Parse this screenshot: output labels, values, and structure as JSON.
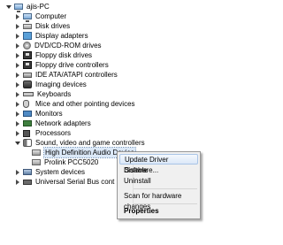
{
  "tree": {
    "root": "ajis-PC",
    "categories": [
      {
        "label": "Computer",
        "icon": "computer-icon"
      },
      {
        "label": "Disk drives",
        "icon": "disk-drive-icon"
      },
      {
        "label": "Display adapters",
        "icon": "display-adapter-icon"
      },
      {
        "label": "DVD/CD-ROM drives",
        "icon": "dvd-icon"
      },
      {
        "label": "Floppy disk drives",
        "icon": "floppy-icon"
      },
      {
        "label": "Floppy drive controllers",
        "icon": "floppy-controller-icon"
      },
      {
        "label": "IDE ATA/ATAPI controllers",
        "icon": "ide-controller-icon"
      },
      {
        "label": "Imaging devices",
        "icon": "camera-icon"
      },
      {
        "label": "Keyboards",
        "icon": "keyboard-icon"
      },
      {
        "label": "Mice and other pointing devices",
        "icon": "mouse-icon"
      },
      {
        "label": "Monitors",
        "icon": "monitor-icon"
      },
      {
        "label": "Network adapters",
        "icon": "network-adapter-icon"
      },
      {
        "label": "Processors",
        "icon": "processor-icon"
      },
      {
        "label": "Sound, video and game controllers",
        "icon": "speaker-icon"
      }
    ],
    "sound_children": [
      {
        "label": "High Definition Audio Device",
        "icon": "audio-device-icon"
      },
      {
        "label": "Prolink PCC5020",
        "icon": "audio-device-icon"
      }
    ],
    "tail": [
      {
        "label": "System devices",
        "icon": "system-devices-icon"
      },
      {
        "label": "Universal Serial Bus cont",
        "icon": "usb-icon"
      }
    ]
  },
  "context_menu": {
    "items": [
      {
        "label": "Update Driver Software..."
      },
      {
        "label": "Disable"
      },
      {
        "label": "Uninstall"
      },
      {
        "label": "Scan for hardware changes"
      },
      {
        "label": "Properties"
      }
    ]
  }
}
